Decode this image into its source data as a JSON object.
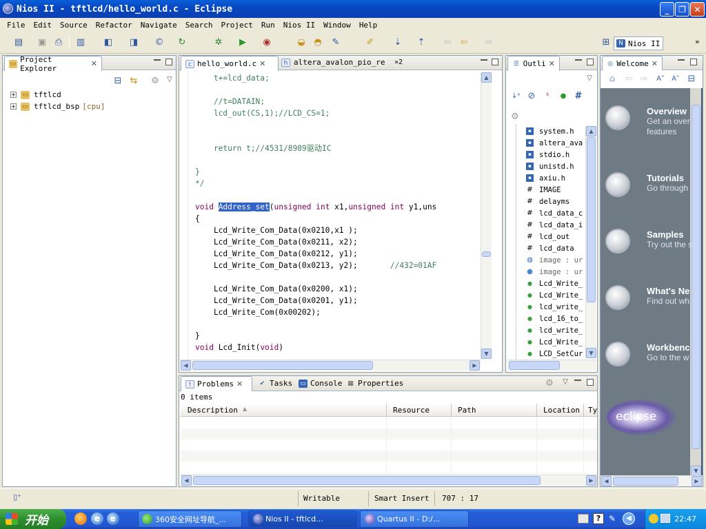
{
  "window": {
    "title": "Nios II - tftlcd/hello_world.c - Eclipse"
  },
  "menu": [
    "File",
    "Edit",
    "Source",
    "Refactor",
    "Navigate",
    "Search",
    "Project",
    "Run",
    "Nios II",
    "Window",
    "Help"
  ],
  "perspective": {
    "label": "Nios II"
  },
  "project_explorer": {
    "title": "Project Explorer",
    "items": [
      {
        "name": "tftlcd",
        "suffix": ""
      },
      {
        "name": "tftlcd_bsp",
        "suffix": "[cpu]"
      }
    ]
  },
  "editor": {
    "tabs": [
      "hello_world.c",
      "altera_avalon_pio_re",
      "»2"
    ],
    "lines": [
      {
        "text": "    t+=lcd_data;",
        "kind": "comment"
      },
      {
        "text": "",
        "kind": "plain"
      },
      {
        "text": "    //t=DATAIN;",
        "kind": "comment"
      },
      {
        "text": "    lcd_out(CS,1);//LCD_CS=1;",
        "kind": "comment"
      },
      {
        "text": "",
        "kind": "plain"
      },
      {
        "text": "",
        "kind": "plain"
      },
      {
        "text": "    return t;//4531/8989驱动IC",
        "kind": "comment"
      },
      {
        "text": "",
        "kind": "plain"
      },
      {
        "text": "}",
        "kind": "comment"
      },
      {
        "text": "*/",
        "kind": "comment"
      },
      {
        "text": "",
        "kind": "plain"
      },
      {
        "text": "void Address_set(unsigned int x1,unsigned int y1,uns",
        "kind": "signature"
      },
      {
        "text": "{",
        "kind": "plain"
      },
      {
        "text": "    Lcd_Write_Com_Data(0x0210,x1 );",
        "kind": "plain"
      },
      {
        "text": "    Lcd_Write_Com_Data(0x0211, x2);",
        "kind": "plain"
      },
      {
        "text": "    Lcd_Write_Com_Data(0x0212, y1);",
        "kind": "plain"
      },
      {
        "text": "    Lcd_Write_Com_Data(0x0213, y2);       //432=01AF",
        "kind": "plain"
      },
      {
        "text": "",
        "kind": "plain"
      },
      {
        "text": "    Lcd_Write_Com_Data(0x0200, x1);",
        "kind": "plain"
      },
      {
        "text": "    Lcd_Write_Com_Data(0x0201, y1);",
        "kind": "plain"
      },
      {
        "text": "    Lcd_Write_Com(0x00202);",
        "kind": "plain"
      },
      {
        "text": "",
        "kind": "plain"
      },
      {
        "text": "}",
        "kind": "plain"
      },
      {
        "text": "void Lcd_Init(void)",
        "kind": "signature2"
      }
    ]
  },
  "outline": {
    "title": "Outli",
    "items": [
      {
        "label": "system.h",
        "kind": "include"
      },
      {
        "label": "altera_ava",
        "kind": "include"
      },
      {
        "label": "stdio.h",
        "kind": "include"
      },
      {
        "label": "unistd.h",
        "kind": "include"
      },
      {
        "label": "axiu.h",
        "kind": "include"
      },
      {
        "label": "IMAGE",
        "kind": "macro"
      },
      {
        "label": "delayms",
        "kind": "macro"
      },
      {
        "label": "lcd_data_c",
        "kind": "macro"
      },
      {
        "label": "lcd_data_i",
        "kind": "macro"
      },
      {
        "label": "lcd_out",
        "kind": "macro"
      },
      {
        "label": "lcd_data",
        "kind": "macro"
      },
      {
        "label": "image : ur",
        "kind": "var-disabled"
      },
      {
        "label": "image : ur",
        "kind": "var"
      },
      {
        "label": "Lcd_Write_",
        "kind": "func"
      },
      {
        "label": "Lcd_Write_",
        "kind": "func"
      },
      {
        "label": "lcd_write_",
        "kind": "func"
      },
      {
        "label": "lcd_16_to_",
        "kind": "func"
      },
      {
        "label": "lcd_write_",
        "kind": "func"
      },
      {
        "label": "Lcd_Write_",
        "kind": "func"
      },
      {
        "label": "LCD_SetCur",
        "kind": "func"
      }
    ]
  },
  "welcome": {
    "title": "Welcome",
    "entries": [
      {
        "title": "Overview",
        "desc1": "Get an over",
        "desc2": "features"
      },
      {
        "title": "Tutorials",
        "desc1": "Go through",
        "desc2": ""
      },
      {
        "title": "Samples",
        "desc1": "Try out the s",
        "desc2": ""
      },
      {
        "title": "What's Ne",
        "desc1": "Find out wh",
        "desc2": ""
      },
      {
        "title": "Workbenc",
        "desc1": "Go to the w",
        "desc2": ""
      }
    ],
    "logo": "eclipse"
  },
  "problems": {
    "tabs": [
      "Problems",
      "Tasks",
      "Console",
      "Properties"
    ],
    "count": "0 items",
    "columns": [
      "Description",
      "Resource",
      "Path",
      "Location",
      "Ty"
    ]
  },
  "statusbar": {
    "writable": "Writable",
    "insert": "Smart Insert",
    "position": "707 : 17"
  },
  "taskbar": {
    "start": "开始",
    "tasks": [
      "360安全网址导航_...",
      "Nios II - tftlcd...",
      "Quartus II - D:/..."
    ],
    "clock": "22:47"
  }
}
